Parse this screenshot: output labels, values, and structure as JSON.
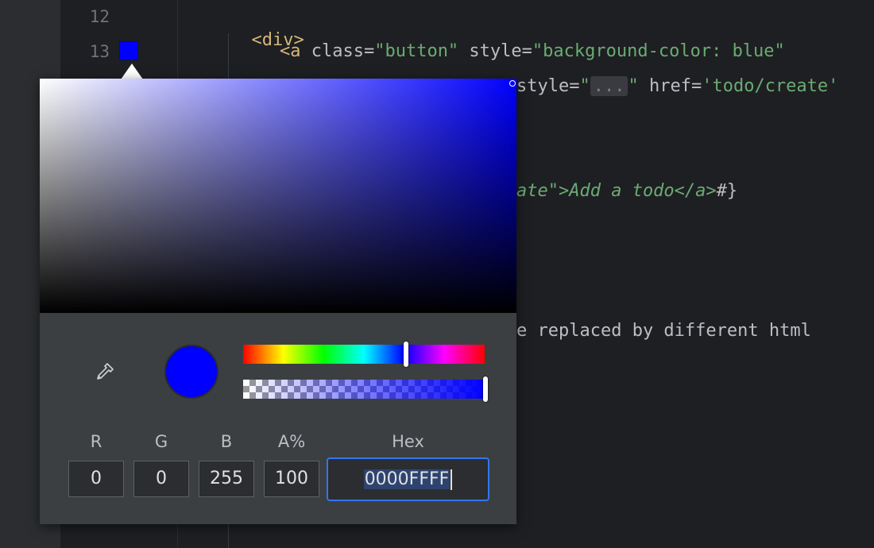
{
  "editor": {
    "line_numbers": [
      "12",
      "13"
    ],
    "lines": {
      "l12_tag": "<div>",
      "l13_open": "<a",
      "l13_class_attr": " class=",
      "l13_class_val": "\"button\"",
      "l13_style_attr": " style=",
      "l13_style_val": "\"background-color: blue\"",
      "l14_style_attr": "style=",
      "l14_quote_open": "\"",
      "l14_fold": "...",
      "l14_quote_close": "\"",
      "l14_href_attr": " href=",
      "l14_href_val": "'todo/create'",
      "l16_ital": "ate\">Add a todo</a>",
      "l16_tail": "#}",
      "l22_text": "e replaced by different html"
    },
    "swatch_color": "#0000ff"
  },
  "color_picker": {
    "labels": {
      "r": "R",
      "g": "G",
      "b": "B",
      "a": "A%",
      "hex": "Hex"
    },
    "values": {
      "r": "0",
      "g": "0",
      "b": "255",
      "a": "100",
      "hex": "0000FFFF"
    },
    "current_color": "#0000ff",
    "hue_position": 0.667,
    "alpha_position": 1.0,
    "icons": {
      "eyedropper": "eyedropper-icon"
    }
  }
}
